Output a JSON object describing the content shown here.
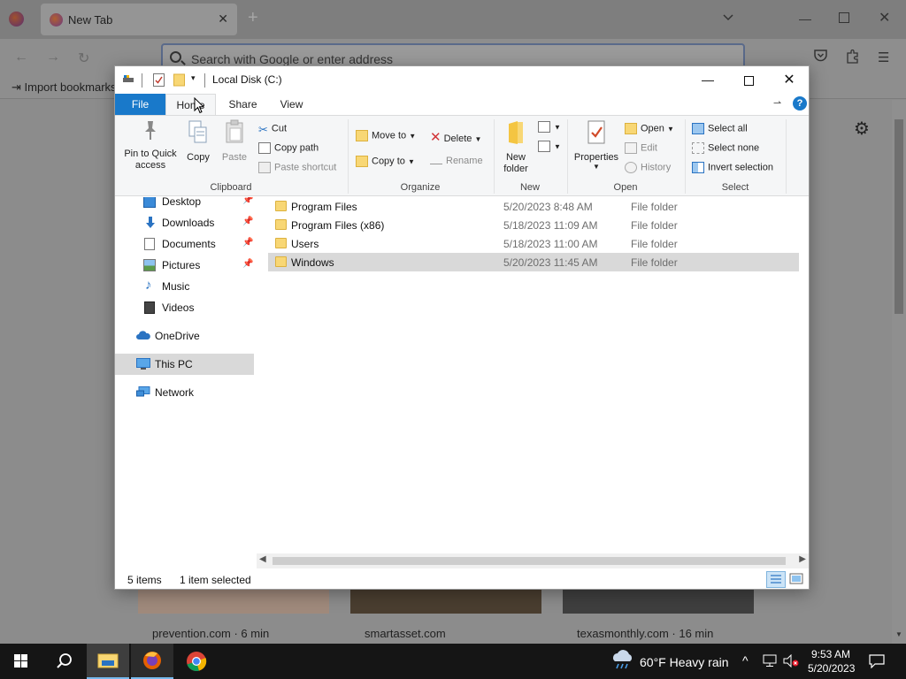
{
  "browser": {
    "tab_title": "New Tab",
    "url_placeholder": "Search with Google or enter address",
    "import_bookmarks": "Import bookmarks",
    "cards": [
      {
        "source": "prevention.com · 6 min"
      },
      {
        "source": "smartasset.com"
      },
      {
        "source": "texasmonthly.com · 16 min"
      }
    ]
  },
  "explorer": {
    "title": "Local Disk (C:)",
    "tabs": {
      "file": "File",
      "home": "Home",
      "share": "Share",
      "view": "View"
    },
    "ribbon": {
      "clipboard": {
        "label": "Clipboard",
        "pin": "Pin to Quick\naccess",
        "copy": "Copy",
        "paste": "Paste",
        "cut": "Cut",
        "copy_path": "Copy path",
        "paste_shortcut": "Paste shortcut"
      },
      "organize": {
        "label": "Organize",
        "move_to": "Move to",
        "copy_to": "Copy to",
        "delete": "Delete",
        "rename": "Rename"
      },
      "new": {
        "label": "New",
        "new_folder": "New\nfolder"
      },
      "open": {
        "label": "Open",
        "properties": "Properties",
        "open": "Open",
        "edit": "Edit",
        "history": "History"
      },
      "select": {
        "label": "Select",
        "select_all": "Select all",
        "select_none": "Select none",
        "invert": "Invert selection"
      }
    },
    "nav": [
      {
        "label": "Desktop",
        "pinned": true
      },
      {
        "label": "Downloads",
        "pinned": true
      },
      {
        "label": "Documents",
        "pinned": true
      },
      {
        "label": "Pictures",
        "pinned": true
      },
      {
        "label": "Music",
        "pinned": false
      },
      {
        "label": "Videos",
        "pinned": false
      },
      {
        "label": "OneDrive",
        "pinned": false
      },
      {
        "label": "This PC",
        "pinned": false,
        "selected": true
      },
      {
        "label": "Network",
        "pinned": false
      }
    ],
    "files": [
      {
        "name": "Program Files",
        "date": "5/20/2023 8:48 AM",
        "type": "File folder",
        "selected": false
      },
      {
        "name": "Program Files (x86)",
        "date": "5/18/2023 11:09 AM",
        "type": "File folder",
        "selected": false
      },
      {
        "name": "Users",
        "date": "5/18/2023 11:00 AM",
        "type": "File folder",
        "selected": false
      },
      {
        "name": "Windows",
        "date": "5/20/2023 11:45 AM",
        "type": "File folder",
        "selected": true
      }
    ],
    "status": {
      "count": "5 items",
      "selection": "1 item selected"
    }
  },
  "taskbar": {
    "weather": "60°F  Heavy rain",
    "time": "9:53 AM",
    "date": "5/20/2023"
  },
  "colors": {
    "accent": "#1979ca",
    "selection": "#d9d9d9",
    "folder": "#f8d775",
    "taskbar": "#151515"
  }
}
